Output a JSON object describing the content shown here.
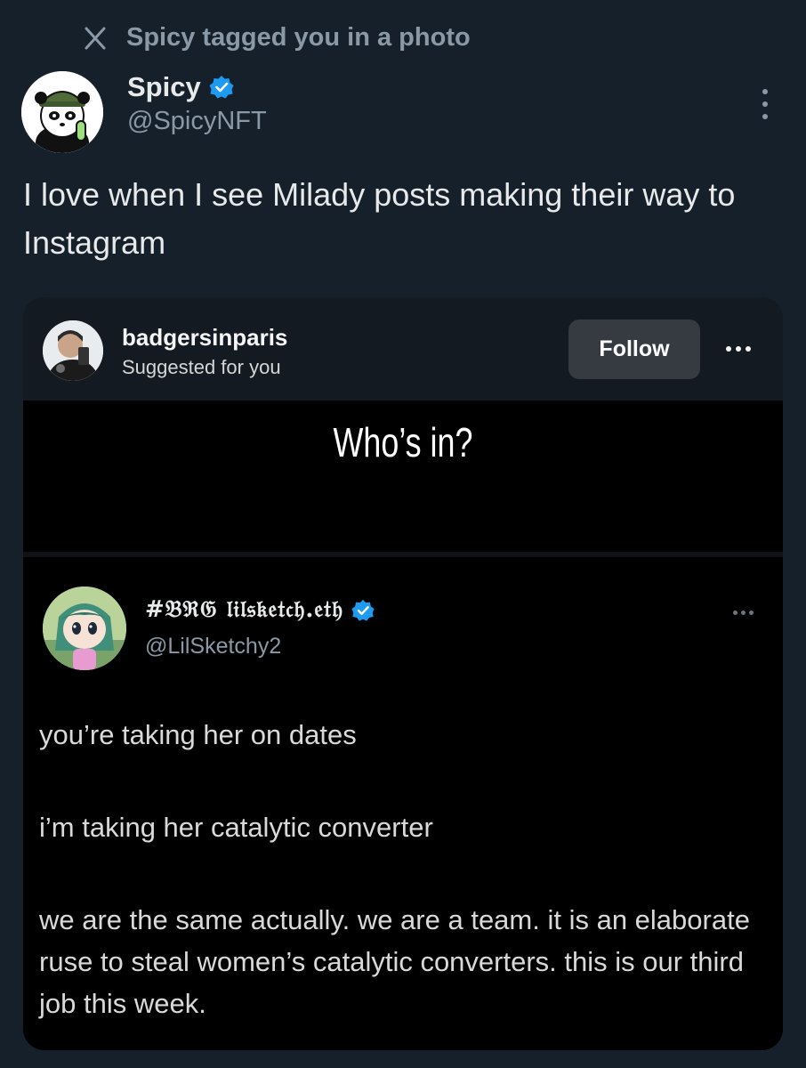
{
  "notification": {
    "text": "Spicy tagged you in a photo",
    "icon": "x-logo-icon"
  },
  "author": {
    "display_name": "Spicy",
    "handle": "@SpicyNFT",
    "verified": true,
    "avatar_icon": "panda-avatar"
  },
  "tweet": {
    "text": "I love when I see Milady posts making their way to Instagram"
  },
  "instagram_post": {
    "username": "badgersinparis",
    "subtitle": "Suggested for you",
    "follow_label": "Follow",
    "meme_heading": "Who’s in?",
    "embedded_tweet": {
      "display_name": "#𝔅ℜ𝔊 𝔩𝔦𝔩𝔰𝔨𝔢𝔱𝔠𝔥.𝔢𝔱𝔥",
      "handle": "@LilSketchy2",
      "verified": true,
      "paragraphs": [
        "you’re taking her on dates",
        "i’m taking her catalytic converter",
        "we are the same actually. we are a team. it is an elaborate ruse to steal women’s catalytic converters. this is our third job this week."
      ]
    }
  },
  "colors": {
    "background": "#15202b",
    "verified_blue": "#1d9bf0",
    "follow_button": "#363b41"
  }
}
